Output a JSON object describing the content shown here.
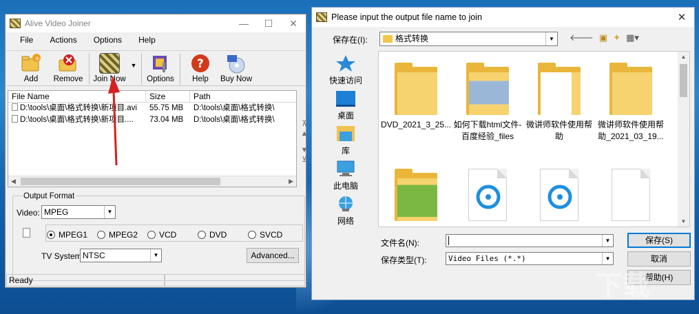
{
  "main_window": {
    "title": "Alive Video Joiner",
    "controls": {
      "minimize": "—",
      "maximize": "☐",
      "close": "✕"
    },
    "menu": [
      "File",
      "Actions",
      "Options",
      "Help"
    ],
    "toolbar": {
      "add": "Add",
      "remove": "Remove",
      "join_now": "Join Now",
      "options": "Options",
      "help": "Help",
      "buy_now": "Buy Now"
    },
    "file_list": {
      "columns": [
        "File Name",
        "Size",
        "Path"
      ],
      "rows": [
        {
          "name": "D:\\tools\\桌面\\格式转换\\新项目.avi",
          "size": "55.75 MB",
          "path": "D:\\tools\\桌面\\格式转换\\"
        },
        {
          "name": "D:\\tools\\桌面\\格式转换\\新项目....",
          "size": "73.04 MB",
          "path": "D:\\tools\\桌面\\格式转换\\"
        }
      ]
    },
    "output_format": {
      "group_label": "Output Format",
      "video_label": "Video:",
      "video_value": "MPEG",
      "radios": [
        {
          "label": "MPEG1",
          "checked": true
        },
        {
          "label": "MPEG2",
          "checked": false
        },
        {
          "label": "VCD",
          "checked": false
        },
        {
          "label": "DVD",
          "checked": false
        },
        {
          "label": "SVCD",
          "checked": false
        }
      ],
      "tv_label": "TV System:",
      "tv_value": "NTSC",
      "advanced_button": "Advanced..."
    },
    "status": "Ready"
  },
  "dialog": {
    "title": "Please input the output file name to join",
    "close": "✕",
    "look_in_label": "保存在(I):",
    "look_in_value": "格式转换",
    "places": [
      "快速访问",
      "桌面",
      "库",
      "此电脑",
      "网络"
    ],
    "items": [
      {
        "name": "DVD_2021_3_25...",
        "type": "folder"
      },
      {
        "name": "如何下载html文件-百度经验_files",
        "type": "folder"
      },
      {
        "name": "微讲师软件使用帮助",
        "type": "folder"
      },
      {
        "name": "微讲师软件使用帮助_2021_03_19...",
        "type": "folder"
      },
      {
        "name": "",
        "type": "folder"
      },
      {
        "name": "",
        "type": "file"
      },
      {
        "name": "",
        "type": "file"
      },
      {
        "name": "",
        "type": "file"
      }
    ],
    "filename_label": "文件名(N):",
    "filename_value": "",
    "filetype_label": "保存类型(T):",
    "filetype_value": "Video Files (*.*)",
    "save_button": "保存(S)",
    "cancel_button": "取消",
    "help_button": "帮助(H)"
  },
  "colors": {
    "desktop": "#1a6fb8",
    "annotation_arrow": "#d42020",
    "folder": "#f6d36e",
    "accent": "#0078d7"
  }
}
